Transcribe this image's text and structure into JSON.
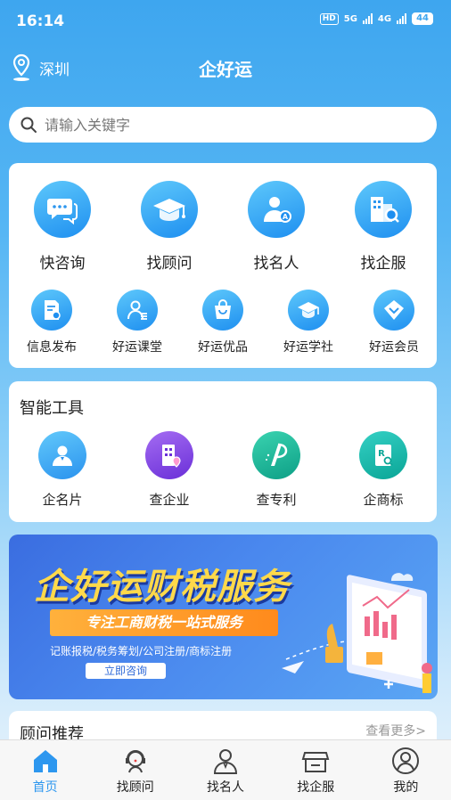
{
  "status_bar": {
    "time": "16:14",
    "hd": "HD",
    "net1": "5G",
    "net2": "4G",
    "battery": "44"
  },
  "header": {
    "location": "深圳",
    "title": "企好运"
  },
  "search": {
    "placeholder": "请输入关键字"
  },
  "main_actions": [
    {
      "label": "快咨询",
      "icon": "chat-bubbles-icon"
    },
    {
      "label": "找顾问",
      "icon": "graduation-cap-icon"
    },
    {
      "label": "找名人",
      "icon": "person-badge-icon"
    },
    {
      "label": "找企服",
      "icon": "building-search-icon"
    }
  ],
  "sub_actions": [
    {
      "label": "信息发布",
      "icon": "document-publish-icon"
    },
    {
      "label": "好运课堂",
      "icon": "teacher-icon"
    },
    {
      "label": "好运优品",
      "icon": "shopping-bag-icon"
    },
    {
      "label": "好运学社",
      "icon": "graduation-cap-icon"
    },
    {
      "label": "好运会员",
      "icon": "diamond-icon"
    }
  ],
  "tools": {
    "title": "智能工具",
    "items": [
      {
        "label": "企名片",
        "icon": "user-card-icon",
        "color": "#3aa4ef"
      },
      {
        "label": "查企业",
        "icon": "building-location-icon",
        "color": "#7a3fe0"
      },
      {
        "label": "查专利",
        "icon": "patent-icon",
        "color": "#19b89a"
      },
      {
        "label": "企商标",
        "icon": "trademark-icon",
        "color": "#16b7a6"
      }
    ]
  },
  "banner": {
    "title": "企好运财税服务",
    "subtitle": "专注工商财税一站式服务",
    "description": "记账报税/税务筹划/公司注册/商标注册",
    "button": "立即咨询"
  },
  "recommend": {
    "title": "顾问推荐",
    "more": "查看更多>"
  },
  "tabbar": [
    {
      "label": "首页",
      "icon": "home-icon",
      "active": true
    },
    {
      "label": "找顾问",
      "icon": "advisor-headset-icon",
      "active": false
    },
    {
      "label": "找名人",
      "icon": "person-icon",
      "active": false
    },
    {
      "label": "找企服",
      "icon": "store-icon",
      "active": false
    },
    {
      "label": "我的",
      "icon": "profile-icon",
      "active": false
    }
  ],
  "colors": {
    "primary": "#2d97ef",
    "background_top": "#3ea6ef",
    "banner_title": "#ffd94a",
    "banner_button_bg": "#ff8a1c"
  }
}
